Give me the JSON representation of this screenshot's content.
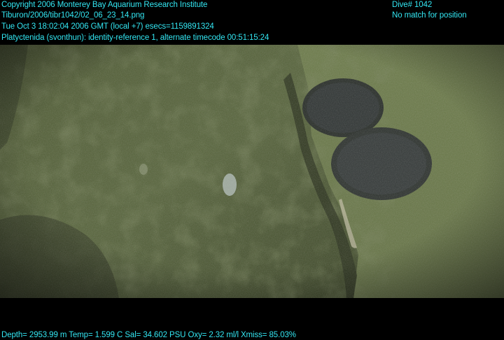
{
  "overlay": {
    "copyright": "Copyright 2006 Monterey Bay Aquarium Research Institute",
    "image_path": "Tiburon/2006/tibr1042/02_06_23_14.png",
    "datetime": "Tue Oct  3 18:02:04 2006 GMT (local +7)  esecs=1159891324",
    "annotation": "Platyctenida (svonthun): identity-reference 1, alternate timecode 00:51:15:24",
    "dive": "Dive# 1042",
    "position_status": "No match for position",
    "sensors": "Depth= 2953.99 m  Temp= 1.599 C  Sal= 34.602 PSU  Oxy= 2.32 ml/l  Xmiss= 85.03%"
  },
  "colors": {
    "overlay_text": "#33e6f2",
    "background": "#000000",
    "sediment": "#5a6a3a"
  }
}
